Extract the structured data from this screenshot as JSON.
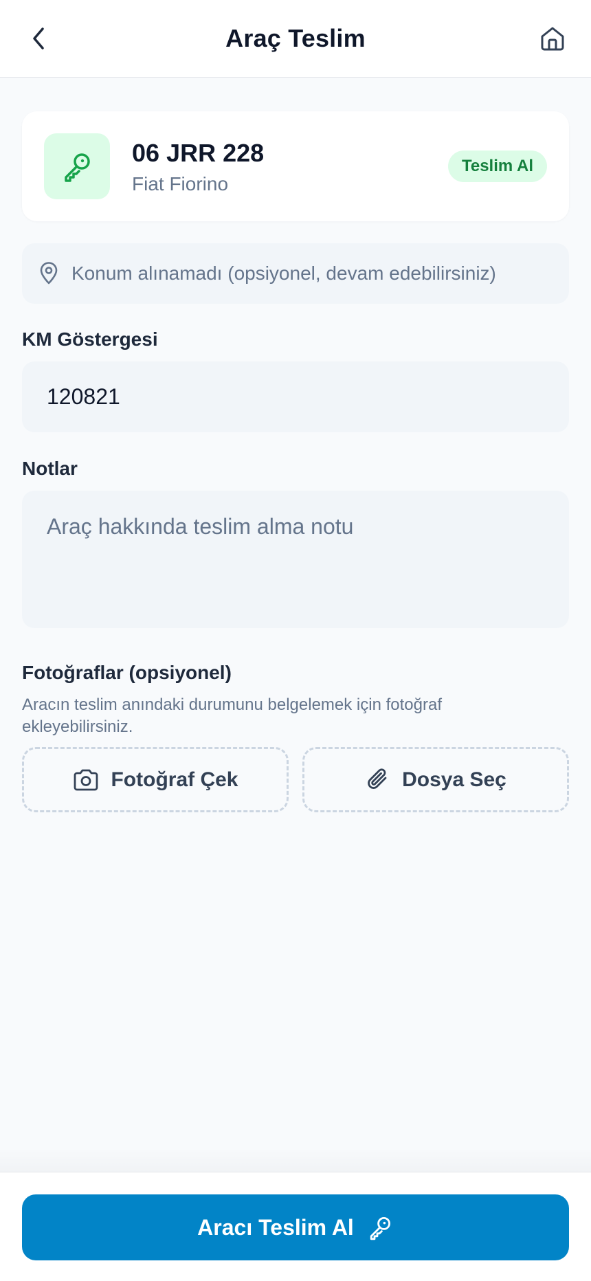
{
  "header": {
    "title": "Araç Teslim",
    "back_icon": "chevron-left-icon",
    "home_icon": "home-icon"
  },
  "vehicle": {
    "plate": "06 JRR 228",
    "model": "Fiat Fiorino",
    "badge": "Teslim Al",
    "icon": "key-icon"
  },
  "location": {
    "icon": "map-pin-icon",
    "text": "Konum alınamadı (opsiyonel, devam edebilirsiniz)"
  },
  "km": {
    "label": "KM Göstergesi",
    "value": "120821"
  },
  "notes": {
    "label": "Notlar",
    "placeholder": "Araç hakkında teslim alma notu",
    "value": ""
  },
  "photos": {
    "label": "Fotoğraflar (opsiyonel)",
    "description": "Aracın teslim anındaki durumunu belgelemek için fotoğraf ekleyebilirsiniz.",
    "camera_label": "Fotoğraf Çek",
    "file_label": "Dosya Seç"
  },
  "footer": {
    "submit_label": "Aracı Teslim Al"
  },
  "colors": {
    "primary": "#0284c7",
    "success_bg": "#dcfce7",
    "success_text": "#15803d",
    "muted_text": "#64748b",
    "field_bg": "#f1f5f9"
  }
}
